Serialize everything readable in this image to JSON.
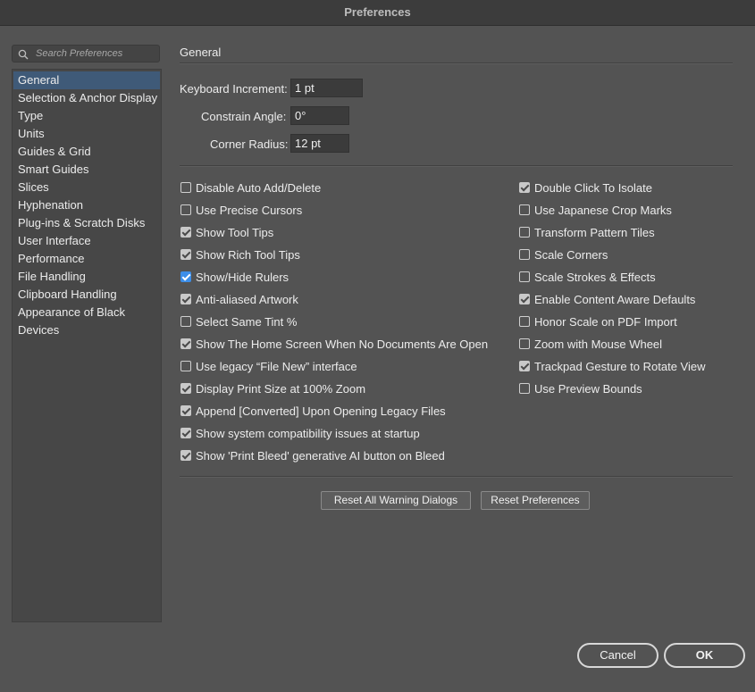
{
  "window": {
    "title": "Preferences"
  },
  "search": {
    "placeholder": "Search Preferences"
  },
  "sidebar": {
    "items": [
      {
        "label": "General",
        "selected": true
      },
      {
        "label": "Selection & Anchor Display"
      },
      {
        "label": "Type"
      },
      {
        "label": "Units"
      },
      {
        "label": "Guides & Grid"
      },
      {
        "label": "Smart Guides"
      },
      {
        "label": "Slices"
      },
      {
        "label": "Hyphenation"
      },
      {
        "label": "Plug-ins & Scratch Disks"
      },
      {
        "label": "User Interface"
      },
      {
        "label": "Performance"
      },
      {
        "label": "File Handling"
      },
      {
        "label": "Clipboard Handling"
      },
      {
        "label": "Appearance of Black"
      },
      {
        "label": "Devices"
      }
    ]
  },
  "general": {
    "title": "General",
    "keyboard_increment": {
      "label": "Keyboard Increment:",
      "value": "1 pt"
    },
    "constrain_angle": {
      "label": "Constrain Angle:",
      "value": "0°"
    },
    "corner_radius": {
      "label": "Corner Radius:",
      "value": "12 pt"
    }
  },
  "options_left": [
    {
      "label": "Disable Auto Add/Delete",
      "checked": false
    },
    {
      "label": "Use Precise Cursors",
      "checked": false
    },
    {
      "label": "Show Tool Tips",
      "checked": true
    },
    {
      "label": "Show Rich Tool Tips",
      "checked": true
    },
    {
      "label": "Show/Hide Rulers",
      "checked": true,
      "accent": "#3d8ee8"
    },
    {
      "label": "Anti-aliased Artwork",
      "checked": true
    },
    {
      "label": "Select Same Tint %",
      "checked": false
    },
    {
      "label": "Show The Home Screen When No Documents Are Open",
      "checked": true
    },
    {
      "label": "Use legacy “File New” interface",
      "checked": false
    },
    {
      "label": "Display Print Size at 100% Zoom",
      "checked": true
    },
    {
      "label": "Append [Converted] Upon Opening Legacy Files",
      "checked": true
    },
    {
      "label": "Show system compatibility issues at startup",
      "checked": true
    },
    {
      "label": "Show 'Print Bleed' generative AI button on Bleed",
      "checked": true
    }
  ],
  "options_right": [
    {
      "label": "Double Click To Isolate",
      "checked": true
    },
    {
      "label": "Use Japanese Crop Marks",
      "checked": false
    },
    {
      "label": "Transform Pattern Tiles",
      "checked": false
    },
    {
      "label": "Scale Corners",
      "checked": false
    },
    {
      "label": "Scale Strokes & Effects",
      "checked": false
    },
    {
      "label": "Enable Content Aware Defaults",
      "checked": true
    },
    {
      "label": "Honor Scale on PDF Import",
      "checked": false
    },
    {
      "label": "Zoom with Mouse Wheel",
      "checked": false
    },
    {
      "label": "Trackpad Gesture to Rotate View",
      "checked": true
    },
    {
      "label": "Use Preview Bounds",
      "checked": false
    }
  ],
  "buttons": {
    "reset_warnings": "Reset All Warning Dialogs",
    "reset_prefs": "Reset Preferences",
    "cancel": "Cancel",
    "ok": "OK"
  }
}
